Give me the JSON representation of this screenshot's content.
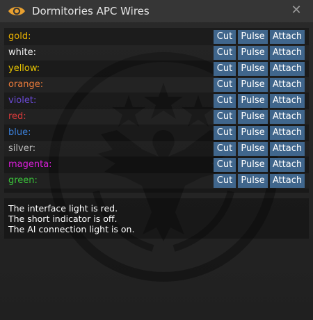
{
  "window": {
    "title": "Dormitories APC Wires",
    "close_glyph": "✕",
    "icon": "eye-icon"
  },
  "wires": [
    {
      "label": "gold:",
      "color": "#e8b000"
    },
    {
      "label": "white:",
      "color": "#f0f0f0"
    },
    {
      "label": "yellow:",
      "color": "#e6c300"
    },
    {
      "label": "orange:",
      "color": "#e87a3a"
    },
    {
      "label": "violet:",
      "color": "#6a4ad6"
    },
    {
      "label": "red:",
      "color": "#d83a3a"
    },
    {
      "label": "blue:",
      "color": "#3a7fd8"
    },
    {
      "label": "silver:",
      "color": "#bdbdbd"
    },
    {
      "label": "magenta:",
      "color": "#d81ed8"
    },
    {
      "label": "green:",
      "color": "#3ac23a"
    }
  ],
  "actions": {
    "cut": "Cut",
    "pulse": "Pulse",
    "attach": "Attach"
  },
  "status": {
    "lines": [
      "The interface light is red.",
      "The short indicator is off.",
      "The AI connection light is on."
    ]
  },
  "colors": {
    "button": "#40668c",
    "titlebar": "#363636",
    "eye_icon": "#e8a030"
  }
}
